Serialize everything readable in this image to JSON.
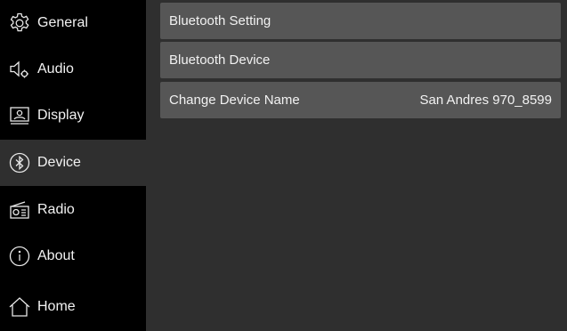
{
  "sidebar": {
    "items": [
      {
        "label": "General",
        "icon": "gear-icon"
      },
      {
        "label": "Audio",
        "icon": "speaker-settings-icon"
      },
      {
        "label": "Display",
        "icon": "display-icon"
      },
      {
        "label": "Device",
        "icon": "bluetooth-icon",
        "active": true
      },
      {
        "label": "Radio",
        "icon": "radio-icon"
      },
      {
        "label": "About",
        "icon": "info-icon"
      },
      {
        "label": "Home",
        "icon": "home-icon"
      }
    ]
  },
  "main": {
    "rows": [
      {
        "label": "Bluetooth Setting",
        "value": ""
      },
      {
        "label": "Bluetooth Device",
        "value": ""
      },
      {
        "label": "Change Device Name",
        "value": "San Andres 970_8599"
      }
    ]
  },
  "colors": {
    "sidebar_bg": "#000000",
    "content_bg": "#2f2f2f",
    "row_bg": "#565656",
    "text": "#f2f2f2"
  }
}
